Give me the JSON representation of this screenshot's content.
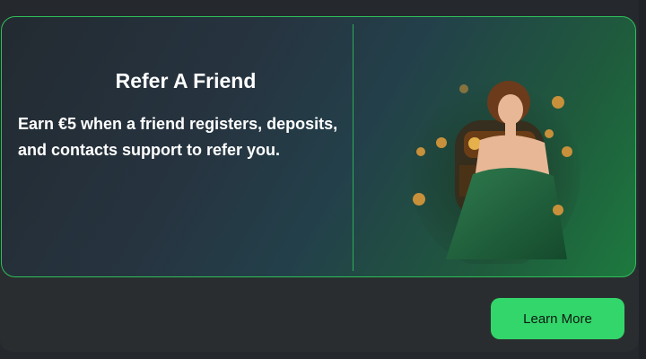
{
  "promo": {
    "title": "Refer A Friend",
    "description": "Earn €5 when a friend registers, deposits, and contacts support to refer you.",
    "image_icon": "casino-woman-slot-machine-coins-illustration"
  },
  "actions": {
    "learn_more_label": "Learn More"
  },
  "colors": {
    "accent": "#33d66a",
    "card_border": "#2fbf5a",
    "background": "#25292d"
  }
}
